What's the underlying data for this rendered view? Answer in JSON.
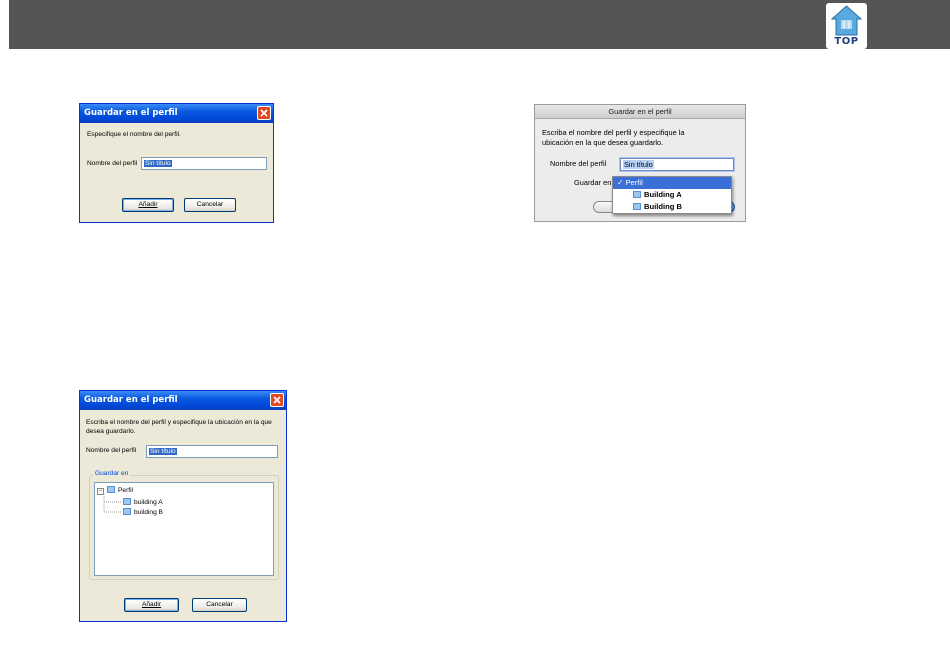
{
  "header": {
    "top_label": "TOP",
    "top_icon": "home-icon"
  },
  "dialog_xp_simple": {
    "title": "Guardar en el perfil",
    "instruction": "Especifique el nombre del perfil.",
    "name_label": "Nombre del perfil",
    "name_value": "Sin título",
    "add_label": "Añadir",
    "cancel_label": "Cancelar"
  },
  "dialog_mac": {
    "title": "Guardar en el perfil",
    "instruction_line1": "Escriba el nombre del perfil y especifique la",
    "instruction_line2": "ubicación en la que desea guardarlo.",
    "name_label": "Nombre del perfil",
    "name_value": "Sin título",
    "save_in_label": "Guardar en",
    "menu": {
      "items": [
        {
          "label": "Perfil",
          "checked": true
        },
        {
          "label": "Building A"
        },
        {
          "label": "Building B"
        }
      ]
    }
  },
  "dialog_xp_tree": {
    "title": "Guardar en el perfil",
    "instruction_line1": "Escriba el nombre del perfil y especifique la ubicación en la que",
    "instruction_line2": "desea guardarlo.",
    "name_label": "Nombre del perfil",
    "name_value": "Sin título",
    "save_in_label": "Guardar en",
    "tree": {
      "root": "Perfil",
      "children": [
        "building A",
        "building B"
      ]
    },
    "add_label": "Añadir",
    "cancel_label": "Cancelar"
  },
  "colors": {
    "xp_title": "#0a58e0",
    "xp_face": "#ece9d8",
    "mac_selection": "#3a6fd8",
    "header_band": "#555555"
  }
}
